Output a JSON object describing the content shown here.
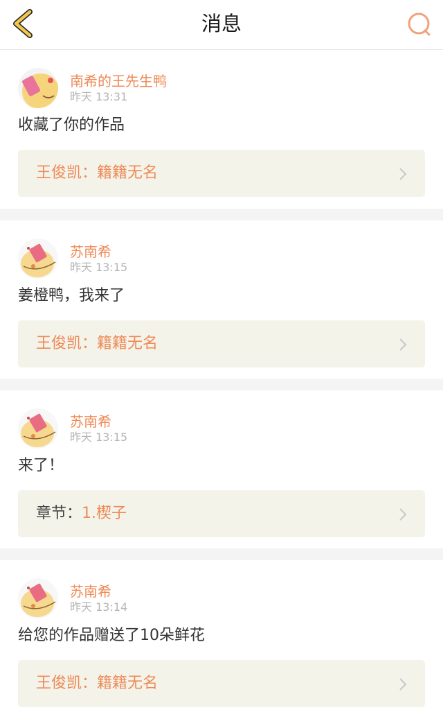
{
  "header": {
    "title": "消息",
    "back_icon": "chevron-left-icon",
    "search_icon": "search-icon",
    "accent_color": "#f2c84b",
    "search_color": "#f0a27c"
  },
  "notifications": [
    {
      "username": "南希的王先生鸭",
      "time": "昨天 13:31",
      "message": "收藏了你的作品",
      "ref_prefix": "王俊凯：",
      "ref_title": "籍籍无名"
    },
    {
      "username": "苏南希",
      "time": "昨天 13:15",
      "message": "姜橙鸭，我来了",
      "ref_prefix": "王俊凯：",
      "ref_title": "籍籍无名"
    },
    {
      "username": "苏南希",
      "time": "昨天 13:15",
      "message": "来了！",
      "ref_prefix": "章节：",
      "ref_title": "1.楔子"
    },
    {
      "username": "苏南希",
      "time": "昨天 13:14",
      "message": "给您的作品赠送了10朵鲜花",
      "ref_prefix": "王俊凯：",
      "ref_title": "籍籍无名"
    }
  ],
  "colors": {
    "username": "#ee8a57",
    "time": "#b5b5b5",
    "ref_background": "#f4f3ea",
    "page_background": "#f4f4f4"
  }
}
